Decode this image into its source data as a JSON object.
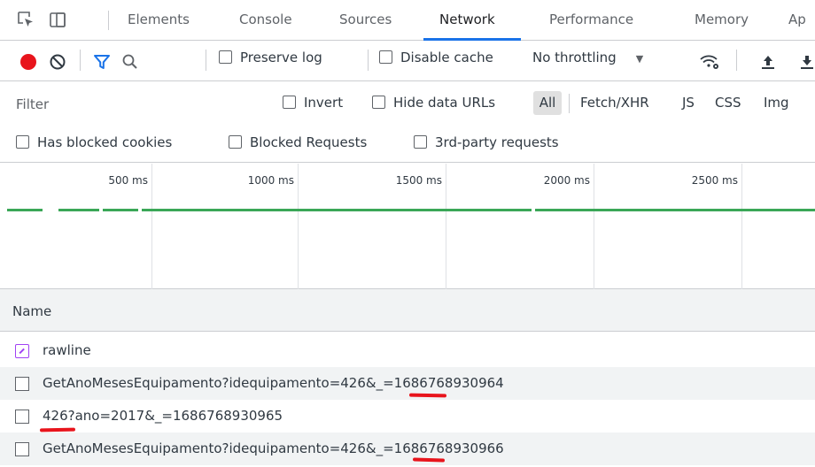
{
  "tabs": [
    "Elements",
    "Console",
    "Sources",
    "Network",
    "Performance",
    "Memory",
    "Ap"
  ],
  "active_tab": "Network",
  "toolbar": {
    "preserve_log": "Preserve log",
    "disable_cache": "Disable cache",
    "throttling": "No throttling"
  },
  "filter": {
    "placeholder": "Filter",
    "invert": "Invert",
    "hide_data_urls": "Hide data URLs",
    "all": "All",
    "fetch_xhr": "Fetch/XHR",
    "js": "JS",
    "css": "CSS",
    "img": "Img"
  },
  "blocked": {
    "has_blocked_cookies": "Has blocked cookies",
    "blocked_requests": "Blocked Requests",
    "third_party": "3rd-party requests"
  },
  "timeline": {
    "ticks": [
      "500 ms",
      "1000 ms",
      "1500 ms",
      "2000 ms",
      "2500 ms"
    ]
  },
  "list": {
    "header": "Name",
    "rows": [
      {
        "name": "rawline"
      },
      {
        "name": "GetAnoMesesEquipamento?idequipamento=426&_=1686768930964"
      },
      {
        "name": "426?ano=2017&_=1686768930965"
      },
      {
        "name": "GetAnoMesesEquipamento?idequipamento=426&_=1686768930966"
      }
    ]
  },
  "colors": {
    "record": "#e8141c",
    "filter_icon": "#1a73e8",
    "timeline_bar": "#3aa757",
    "annotation": "#e8141c",
    "doc_icon": "#a142f4"
  }
}
